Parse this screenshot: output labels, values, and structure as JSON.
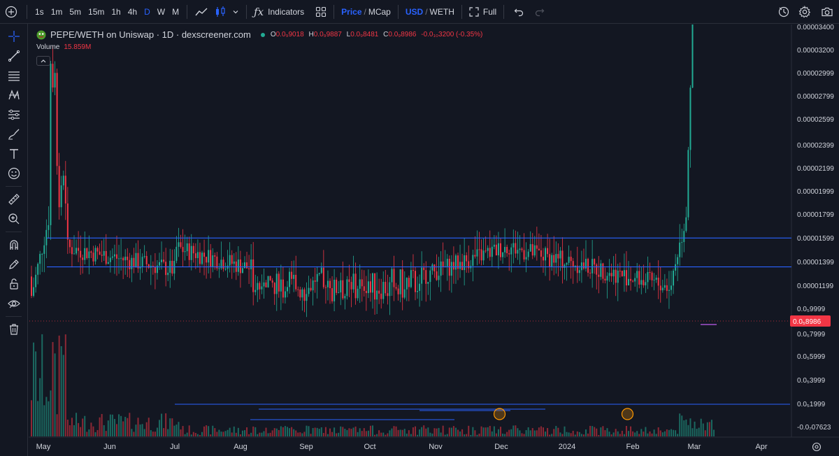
{
  "toolbar": {
    "intervals": [
      "1s",
      "1m",
      "5m",
      "15m",
      "1h",
      "4h",
      "D",
      "W",
      "M"
    ],
    "active_interval": "D",
    "indicators_label": "Indicators",
    "price_label": "Price",
    "mcap_label": "MCap",
    "usd_label": "USD",
    "weth_label": "WETH",
    "full_label": "Full"
  },
  "legend": {
    "symbol": "PEPE/WETH on Uniswap · 1D · dexscreener.com",
    "o_label": "O",
    "o_value": "0.0₉9018",
    "h_label": "H",
    "h_value": "0.0₉9887",
    "l_label": "L",
    "l_value": "0.0₉8481",
    "c_label": "C",
    "c_value": "0.0₉8986",
    "change": "-0.0₁₀3200 (-0.35%)",
    "volume_label": "Volume",
    "volume_value": "15.859M"
  },
  "price_axis": {
    "labels": [
      "0.00003400",
      "0.00003200",
      "0.00002999",
      "0.00002799",
      "0.00002599",
      "0.00002399",
      "0.00002199",
      "0.00001999",
      "0.00001799",
      "0.00001599",
      "0.00001399",
      "0.00001199",
      "0.0₅9999",
      "0.0₅7999",
      "0.0₅5999",
      "0.0₅3999",
      "0.0₅1999",
      "-0.0₇07623"
    ],
    "current_price": "0.0₅8986",
    "current_color": "#f23645"
  },
  "time_axis": {
    "labels": [
      "May",
      "Jun",
      "Jul",
      "Aug",
      "Sep",
      "Oct",
      "Nov",
      "Dec",
      "2024",
      "Feb",
      "Mar",
      "Apr"
    ]
  },
  "colors": {
    "up": "#22ab94",
    "down": "#f23645",
    "drawing": "#2962ff",
    "background": "#131722"
  },
  "chart_data": {
    "type": "candlestick",
    "price_ylim": [
      -7.623e-07,
      3.4e-06
    ],
    "x_range": [
      "2023-04-20",
      "2024-04-20"
    ],
    "drawings": [
      {
        "kind": "horizontal-line",
        "price": 4e-06
      },
      {
        "kind": "horizontal-line",
        "price": 1.2e-06
      },
      {
        "kind": "horizontal-line",
        "price": 9e-07
      },
      {
        "kind": "projection-line",
        "points": [
          [
            "2024-03-10",
            9e-06
          ],
          [
            "2024-03-24",
            2.35e-05
          ],
          [
            "2024-03-29",
            1.99e-05
          ],
          [
            "2024-04-07",
            2.37e-05
          ],
          [
            "2024-04-12",
            3.4e-05
          ]
        ]
      },
      {
        "kind": "horizontal-segment",
        "price": 2.37e-05,
        "from": "2024-03-04",
        "to": "2024-04-07"
      }
    ],
    "circles": [
      "2023-12-01",
      "2024-01-30"
    ]
  }
}
